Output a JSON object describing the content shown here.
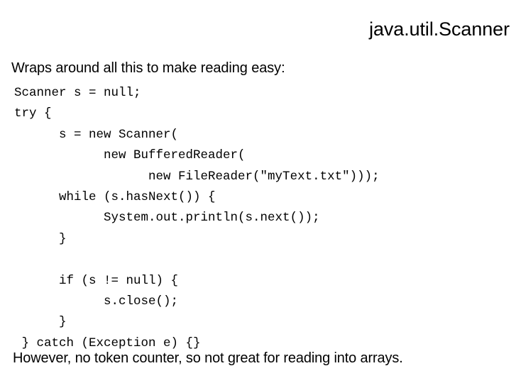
{
  "slide": {
    "title": "java.util.Scanner",
    "intro_line": "Wraps around all this to make reading easy:",
    "footer_note": "However, no token counter, so not great for reading into arrays.",
    "background_color": "#ffffff",
    "text_color": "#000000"
  },
  "code": {
    "language": "java",
    "lines": [
      "Scanner s = null;",
      "try {",
      "      s = new Scanner(",
      "            new BufferedReader(",
      "                  new FileReader(\"myText.txt\")));",
      "      while (s.hasNext()) {",
      "            System.out.println(s.next());",
      "      }",
      "",
      "      if (s != null) {",
      "            s.close();",
      "      }",
      " } catch (Exception e) {}"
    ]
  }
}
